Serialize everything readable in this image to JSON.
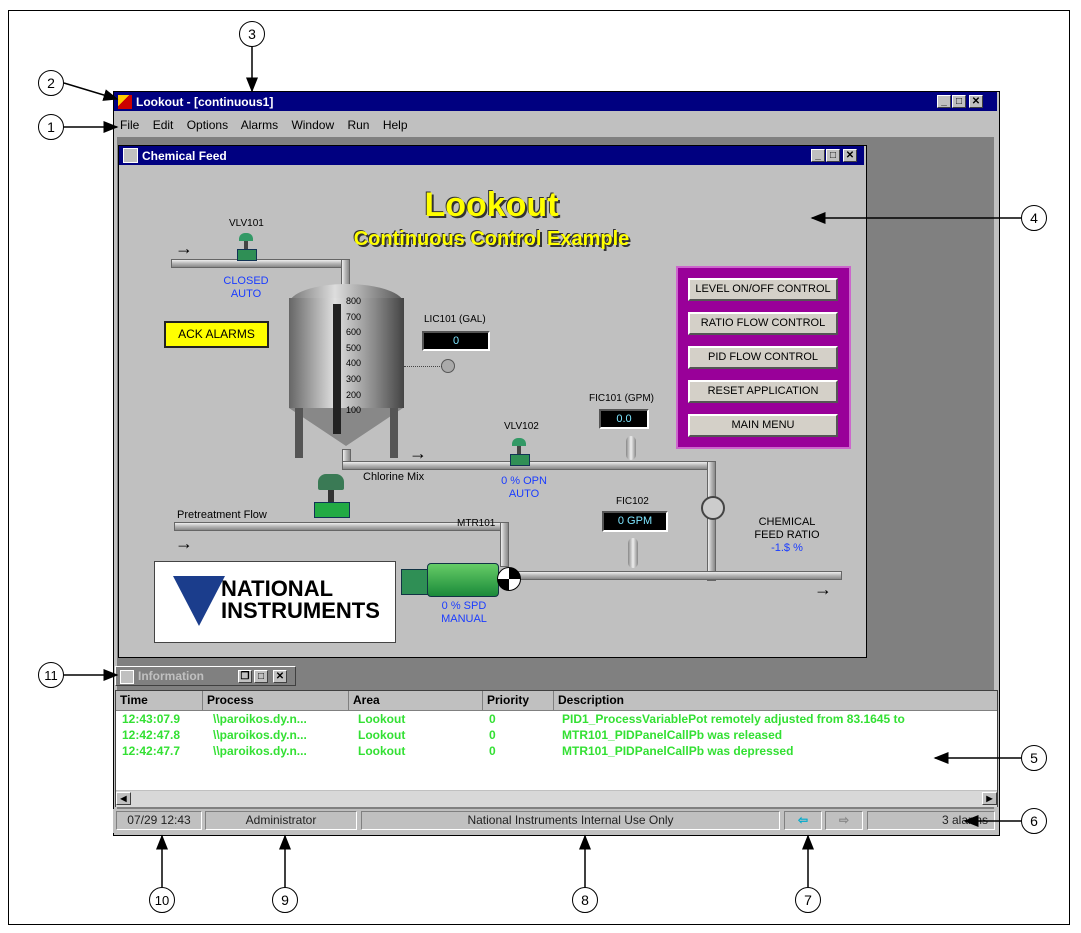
{
  "app": {
    "title": "Lookout - [continuous1]",
    "menu": [
      "File",
      "Edit",
      "Options",
      "Alarms",
      "Window",
      "Run",
      "Help"
    ]
  },
  "chemical_feed": {
    "title": "Chemical Feed",
    "heading": "Lookout",
    "subheading": "Continuous Control Example",
    "ack_alarms": "ACK ALARMS",
    "buttons": [
      "LEVEL ON/OFF CONTROL",
      "RATIO FLOW CONTROL",
      "PID FLOW CONTROL",
      "RESET APPLICATION",
      "MAIN MENU"
    ],
    "vlv101": {
      "label": "VLV101",
      "state": "CLOSED",
      "mode": "AUTO"
    },
    "lic101": {
      "label": "LIC101 (GAL)",
      "value": "0"
    },
    "tank_scale": [
      "800",
      "700",
      "600",
      "500",
      "400",
      "300",
      "200",
      "100"
    ],
    "fic101": {
      "label": "FIC101 (GPM)",
      "value": "0.0"
    },
    "vlv102": {
      "label": "VLV102",
      "state": "0 % OPN",
      "mode": "AUTO"
    },
    "chlorine_mix": "Chlorine Mix",
    "pretreatment_flow": "Pretreatment Flow",
    "fic102": {
      "label": "FIC102",
      "value": "0 GPM"
    },
    "mtr101": {
      "label": "MTR101",
      "state": "0 % SPD",
      "mode": "MANUAL"
    },
    "feed_ratio": {
      "line1": "CHEMICAL",
      "line2": "FEED RATIO",
      "value": "-1.$ %"
    },
    "logo": "NATIONAL INSTRUMENTS"
  },
  "info_window": {
    "title": "Information",
    "columns": [
      "Time",
      "Process",
      "Area",
      "Priority",
      "Description"
    ],
    "rows": [
      {
        "time": "12:43:07.9",
        "process": "\\\\paroikos.dy.n...",
        "area": "Lookout",
        "priority": "0",
        "description": "PID1_ProcessVariablePot remotely adjusted from 83.1645 to"
      },
      {
        "time": "12:42:47.8",
        "process": "\\\\paroikos.dy.n...",
        "area": "Lookout",
        "priority": "0",
        "description": "MTR101_PIDPanelCallPb was released"
      },
      {
        "time": "12:42:47.7",
        "process": "\\\\paroikos.dy.n...",
        "area": "Lookout",
        "priority": "0",
        "description": "MTR101_PIDPanelCallPb was depressed"
      }
    ]
  },
  "status_bar": {
    "datetime": "07/29 12:43",
    "user": "Administrator",
    "message": "National Instruments Internal Use Only",
    "alarms": "3 alarms"
  },
  "callouts": [
    "1",
    "2",
    "3",
    "4",
    "5",
    "6",
    "7",
    "8",
    "9",
    "10",
    "11"
  ],
  "colors": {
    "title_bar": "#000080",
    "workspace": "#808080",
    "alarm_text": "#33e033",
    "accent_yellow": "#ffff00",
    "panel_purple": "#990099"
  }
}
